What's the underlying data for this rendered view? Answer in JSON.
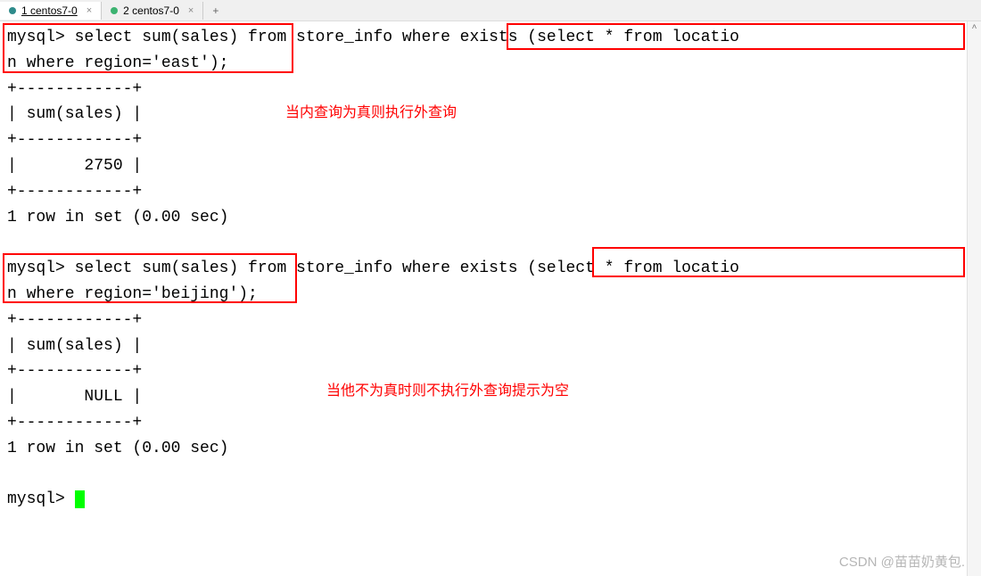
{
  "tabs": {
    "tab1_label": "1 centos7-0",
    "tab2_label": "2 centos7-0",
    "close": "×",
    "add": "+"
  },
  "terminal": {
    "line1": "mysql> select sum(sales) from store_info where exists (select * from locatio",
    "line2": "n where region='east');",
    "line3": "+------------+",
    "line4": "| sum(sales) |",
    "line5": "+------------+",
    "line6": "|       2750 |",
    "line7": "+------------+",
    "line8": "1 row in set (0.00 sec)",
    "line9": "",
    "line10": "mysql> select sum(sales) from store_info where exists (select * from locatio",
    "line11": "n where region='beijing');",
    "line12": "+------------+",
    "line13": "| sum(sales) |",
    "line14": "+------------+",
    "line15": "|       NULL |",
    "line16": "+------------+",
    "line17": "1 row in set (0.00 sec)",
    "line18": "",
    "line19": "mysql> "
  },
  "annotations": {
    "note1": "当内查询为真则执行外查询",
    "note2": "当他不为真时则不执行外查询提示为空"
  },
  "watermark": "CSDN @苗苗奶黄包.",
  "scroll": {
    "up": "^"
  }
}
